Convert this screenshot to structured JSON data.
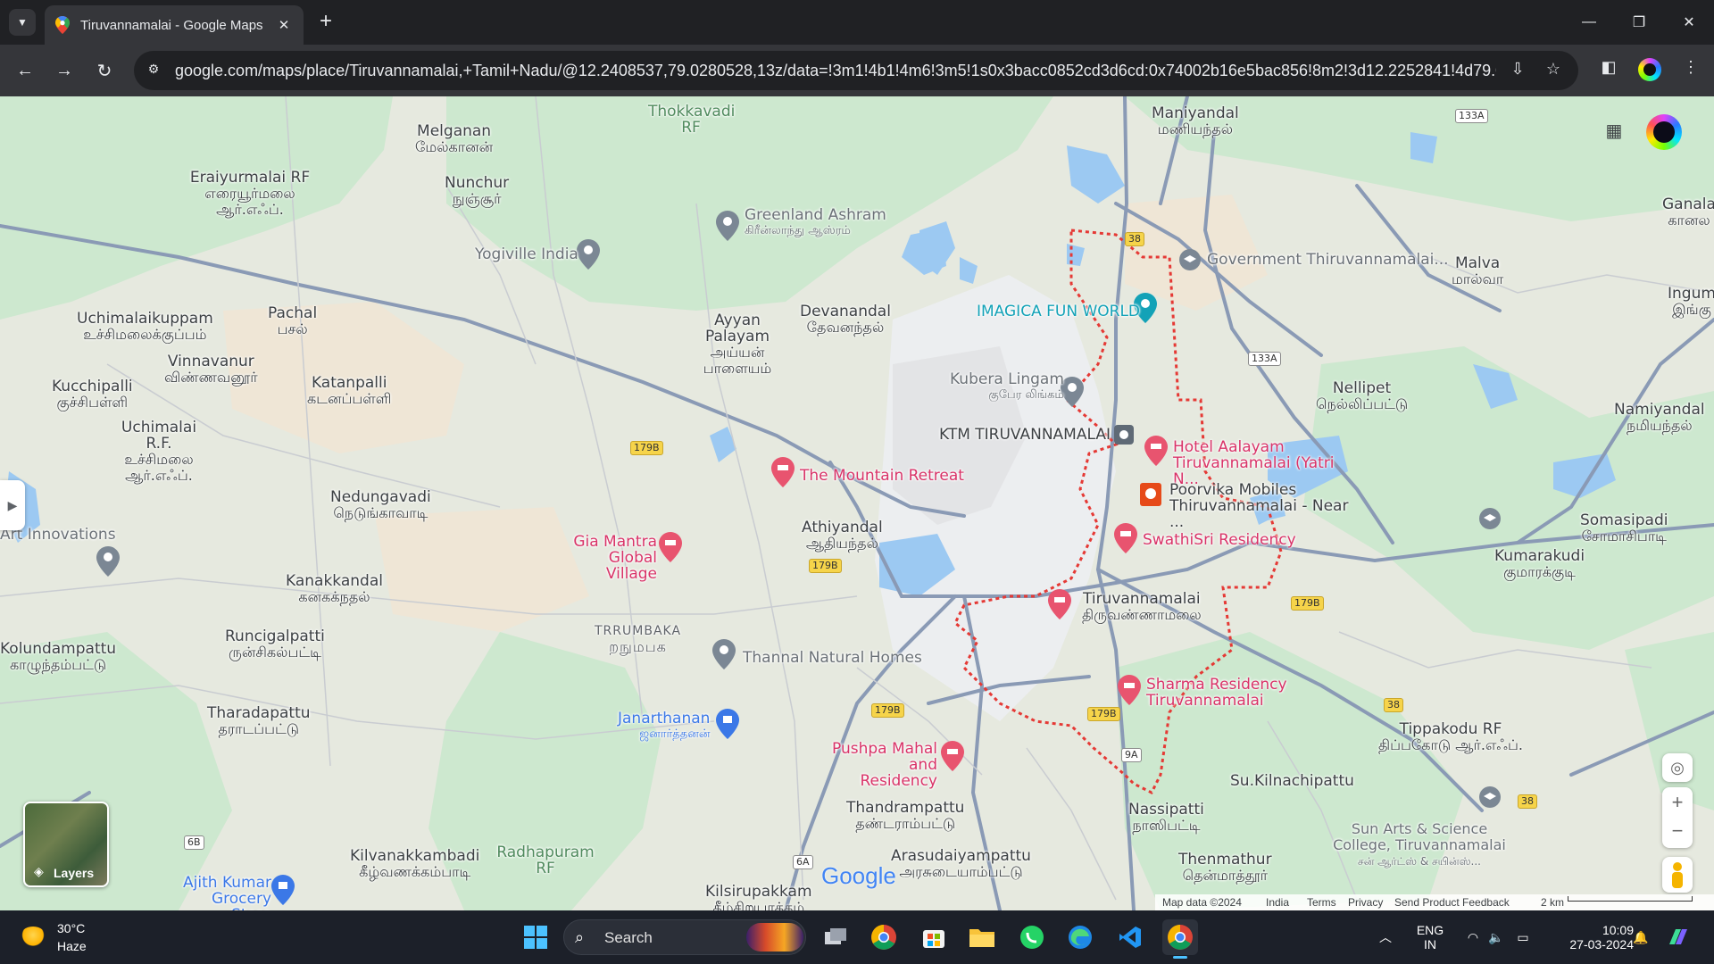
{
  "browser": {
    "tab_title": "Tiruvannamalai - Google Maps",
    "url": "google.com/maps/place/Tiruvannamalai,+Tamil+Nadu/@12.2408537,79.0280528,13z/data=!3m1!4b1!4m6!3m5!1s0x3bacc0852cd3d6cd:0x74002b16e5bac856!8m2!3d12.2252841!4d79.07469..."
  },
  "map": {
    "places": [
      {
        "en": "Maniyandal",
        "ta": "மணியந்தல்"
      },
      {
        "en": "Melganan",
        "ta": "மேல்கானன்"
      },
      {
        "en": "Nunchur",
        "ta": "நுஞ்சூர்"
      },
      {
        "en": "Eraiyurmalai RF",
        "ta": "எரையூர்மலை ஆர்.எஃப்."
      },
      {
        "en": "Uchimalaikuppam",
        "ta": "உச்சிமலைக்குப்பம்"
      },
      {
        "en": "Pachal",
        "ta": "பசல்"
      },
      {
        "en": "Vinnavanur",
        "ta": "விண்ணவனூர்"
      },
      {
        "en": "Kucchipalli",
        "ta": "குச்சிபள்ளி"
      },
      {
        "en": "Katanpalli",
        "ta": "கடனப்பள்ளி"
      },
      {
        "en": "Uchimalai R.F.",
        "ta": "உச்சிமலை ஆர்.எஃப்."
      },
      {
        "en": "Nedungavadi",
        "ta": "நெடுங்காவாடி"
      },
      {
        "en": "Kanakkandal",
        "ta": "கனகக்நதல்"
      },
      {
        "en": "Kolundampattu",
        "ta": "காழுந்தம்பட்டு"
      },
      {
        "en": "Runcigalpatti",
        "ta": "ருன்சிகல்பட்டி"
      },
      {
        "en": "Tharadapattu",
        "ta": "தராடப்பட்டு"
      },
      {
        "en": "Kilvanakkambadi",
        "ta": "கீழ்வணக்கம்பாடி"
      },
      {
        "en": "Ayyan Palayam",
        "ta": "அய்யன் பாளையம்"
      },
      {
        "en": "Devanandal",
        "ta": "தேவனந்தல்"
      },
      {
        "en": "Athiyandal",
        "ta": "ஆதியந்தல்"
      },
      {
        "en": "Tiruvannamalai",
        "ta": "திருவண்ணாமலை"
      },
      {
        "en": "Thandrampattu",
        "ta": "தண்டராம்பட்டு"
      },
      {
        "en": "Arasudaiyampattu",
        "ta": "அரசுடையாம்பட்டு"
      },
      {
        "en": "Kilsirupakkam",
        "ta": "கீழ்சிறுபாக்கம்"
      },
      {
        "en": "Nassipatti",
        "ta": "நாஸிபட்டி"
      },
      {
        "en": "Thenmathur",
        "ta": "தென்மாத்தூர்"
      },
      {
        "en": "Su.Kilnachipattu",
        "ta": ""
      },
      {
        "en": "Tippakodu RF",
        "ta": "திப்பகோடு ஆர்.எஃப்."
      },
      {
        "en": "Kumarakudi",
        "ta": "குமாரக்குடி"
      },
      {
        "en": "Somasipadi",
        "ta": "சோமாசிபாடி"
      },
      {
        "en": "Namiyandal",
        "ta": "நமியந்தல்"
      },
      {
        "en": "Nellipet",
        "ta": "நெல்லிப்பட்டு"
      },
      {
        "en": "Malva",
        "ta": "மால்வா"
      },
      {
        "en": "Ganala",
        "ta": "கானல"
      },
      {
        "en": "Ingum",
        "ta": "இங்கு"
      },
      {
        "en": "Thokkavadi RF",
        "ta": ""
      },
      {
        "en": "Radhapuram RF",
        "ta": ""
      },
      {
        "en": "TRRUMBAKA",
        "ta": "றநுமபக"
      }
    ],
    "pois": [
      {
        "en": "Greenland Ashram",
        "ta": "கிரீன்லாந்து ஆஸ்ரம்"
      },
      {
        "en": "Yogiville India",
        "ta": ""
      },
      {
        "en": "The Mountain Retreat",
        "ta": ""
      },
      {
        "en": "Gia Mantra Global Village",
        "ta": ""
      },
      {
        "en": "Thannal Natural Homes",
        "ta": ""
      },
      {
        "en": "Janarthanan",
        "ta": "ஜனார்த்தனன்"
      },
      {
        "en": "Pushpa Mahal and Residency",
        "ta": ""
      },
      {
        "en": "IMAGICA FUN WORLD",
        "ta": ""
      },
      {
        "en": "Kubera Lingam",
        "ta": "குபேர லிங்கம்"
      },
      {
        "en": "KTM TIRUVANNAMALAI",
        "ta": ""
      },
      {
        "en": "Hotel Aalayam Tiruvannamalai (Yatri N...",
        "ta": ""
      },
      {
        "en": "Poorvika Mobiles Thiruvannamalai - Near ...",
        "ta": ""
      },
      {
        "en": "SwathiSri Residency",
        "ta": ""
      },
      {
        "en": "Sharma Residency Tiruvannamalai",
        "ta": ""
      },
      {
        "en": "Government Thiruvannamalai...",
        "ta": ""
      },
      {
        "en": "Sun Arts & Science College, Tiruvannamalai",
        "ta": "சன் ஆர்ட்ஸ் & சயின்ஸ்..."
      },
      {
        "en": "Ajith Kumar Grocery Store",
        "ta": ""
      },
      {
        "en": "Art Innovations",
        "ta": ""
      }
    ],
    "road_shields": [
      "38",
      "133A",
      "133A",
      "179B",
      "179B",
      "179B",
      "179B",
      "179B",
      "38",
      "38",
      "9A",
      "6B",
      "6A"
    ],
    "layers_label": "Layers",
    "google_logo": "Google",
    "footer": {
      "map_data": "Map data ©2024",
      "country": "India",
      "terms": "Terms",
      "privacy": "Privacy",
      "feedback": "Send Product Feedback",
      "scale": "2 km"
    }
  },
  "taskbar": {
    "temp": "30°C",
    "condition": "Haze",
    "search_label": "Search",
    "lang1": "ENG",
    "lang2": "IN",
    "time": "10:09",
    "date": "27-03-2024"
  },
  "colors": {
    "boundary": "#e53935",
    "road": "#8a9ab5",
    "water": "#8ec3f0",
    "forest": "#c7e6c9"
  }
}
